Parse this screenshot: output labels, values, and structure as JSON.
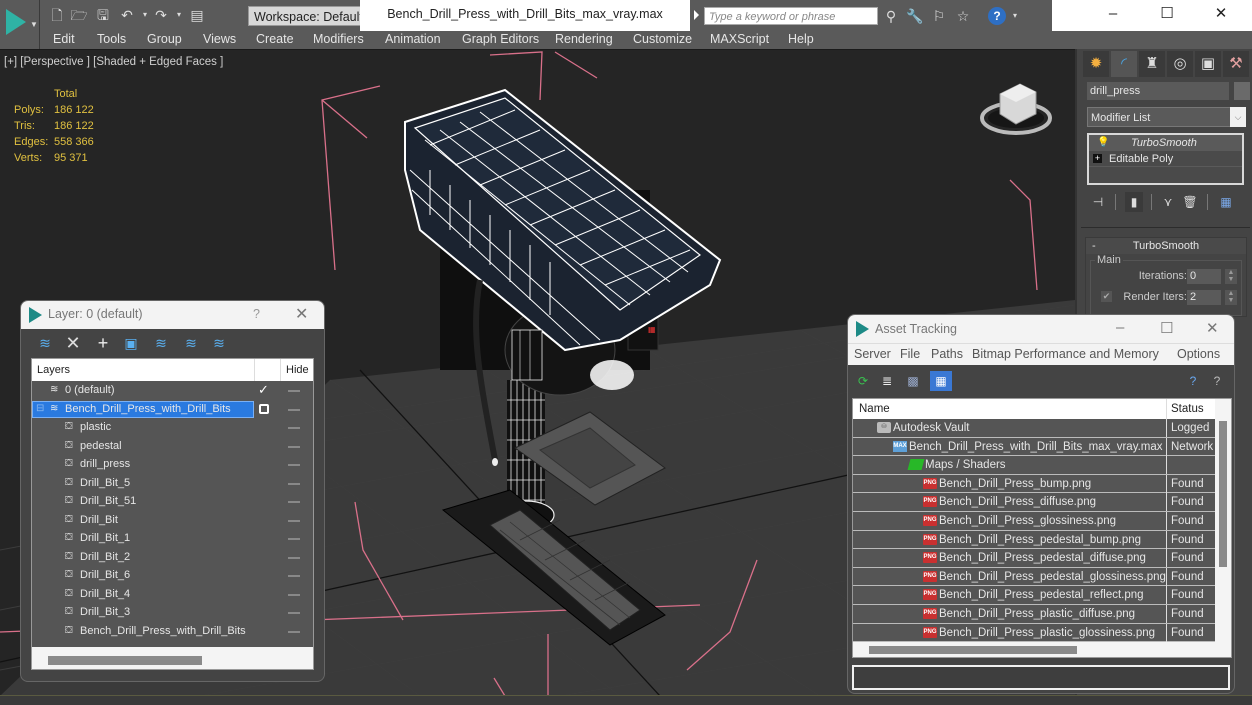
{
  "titlebar": {
    "workspace": "Workspace: Default",
    "document_title": "Bench_Drill_Press_with_Drill_Bits_max_vray.max",
    "search_placeholder": "Type a keyword or phrase",
    "icons": [
      "new-file-icon",
      "open-folder-icon",
      "save-icon",
      "undo-icon",
      "redo-icon",
      "project-folder-icon"
    ],
    "search_icons": [
      "binoculars-icon",
      "key-icon",
      "sign-in-icon",
      "star-icon"
    ],
    "help": "?",
    "minimize": "–",
    "maximize": "☐",
    "close": "✕"
  },
  "menu": [
    "Edit",
    "Tools",
    "Group",
    "Views",
    "Create",
    "Modifiers",
    "Animation",
    "Graph Editors",
    "Rendering",
    "Customize",
    "MAXScript",
    "Help"
  ],
  "viewport": {
    "label": "[+] [Perspective ] [Shaded + Edged Faces ]",
    "stats": {
      "header": "Total",
      "rows": [
        {
          "label": "Polys:",
          "value": "186 122"
        },
        {
          "label": "Tris:",
          "value": "186 122"
        },
        {
          "label": "Edges:",
          "value": "558 366"
        },
        {
          "label": "Verts:",
          "value": "95 371"
        }
      ]
    }
  },
  "command_panel": {
    "tabs": [
      "create-tab",
      "modify-tab",
      "hierarchy-tab",
      "motion-tab",
      "display-tab",
      "utilities-tab"
    ],
    "object_name": "drill_press",
    "modifier_list": "Modifier List",
    "stack": [
      {
        "label": "TurboSmooth",
        "italic": true
      },
      {
        "label": "Editable Poly",
        "italic": false
      }
    ],
    "rollout": {
      "title": "TurboSmooth",
      "minus": "-",
      "group": "Main",
      "iterations_label": "Iterations:",
      "iterations_value": "0",
      "render_iters_label": "Render Iters:",
      "render_iters_value": "2",
      "render_iters_checked": true
    }
  },
  "layer_dialog": {
    "title": "Layer: 0 (default)",
    "help": "?",
    "close": "✕",
    "col_layers": "Layers",
    "col_hide": "Hide",
    "rows": [
      {
        "name": "0 (default)",
        "type": "layer",
        "indent": 1,
        "current": true
      },
      {
        "name": "Bench_Drill_Press_with_Drill_Bits",
        "type": "layer",
        "indent": 1,
        "selected": true
      },
      {
        "name": "plastic",
        "type": "object",
        "indent": 2
      },
      {
        "name": "pedestal",
        "type": "object",
        "indent": 2
      },
      {
        "name": "drill_press",
        "type": "object",
        "indent": 2
      },
      {
        "name": "Drill_Bit_5",
        "type": "object",
        "indent": 2
      },
      {
        "name": "Drill_Bit_51",
        "type": "object",
        "indent": 2
      },
      {
        "name": "Drill_Bit",
        "type": "object",
        "indent": 2
      },
      {
        "name": "Drill_Bit_1",
        "type": "object",
        "indent": 2
      },
      {
        "name": "Drill_Bit_2",
        "type": "object",
        "indent": 2
      },
      {
        "name": "Drill_Bit_6",
        "type": "object",
        "indent": 2
      },
      {
        "name": "Drill_Bit_4",
        "type": "object",
        "indent": 2
      },
      {
        "name": "Drill_Bit_3",
        "type": "object",
        "indent": 2
      },
      {
        "name": "Bench_Drill_Press_with_Drill_Bits",
        "type": "object",
        "indent": 2
      }
    ]
  },
  "asset_dialog": {
    "title": "Asset Tracking",
    "menu": [
      "Server",
      "File",
      "Paths",
      "Bitmap Performance and Memory",
      "Options"
    ],
    "col_name": "Name",
    "col_status": "Status",
    "rows": [
      {
        "name": "Autodesk Vault",
        "status": "Logged",
        "icon": "vault",
        "indent": 1
      },
      {
        "name": "Bench_Drill_Press_with_Drill_Bits_max_vray.max",
        "status": "Network",
        "icon": "maxf",
        "indent": 2
      },
      {
        "name": "Maps / Shaders",
        "status": "",
        "icon": "maps",
        "indent": 3
      },
      {
        "name": "Bench_Drill_Press_bump.png",
        "status": "Found",
        "icon": "png",
        "indent": 4
      },
      {
        "name": "Bench_Drill_Press_diffuse.png",
        "status": "Found",
        "icon": "png",
        "indent": 4
      },
      {
        "name": "Bench_Drill_Press_glossiness.png",
        "status": "Found",
        "icon": "png",
        "indent": 4
      },
      {
        "name": "Bench_Drill_Press_pedestal_bump.png",
        "status": "Found",
        "icon": "png",
        "indent": 4
      },
      {
        "name": "Bench_Drill_Press_pedestal_diffuse.png",
        "status": "Found",
        "icon": "png",
        "indent": 4
      },
      {
        "name": "Bench_Drill_Press_pedestal_glossiness.png",
        "status": "Found",
        "icon": "png",
        "indent": 4
      },
      {
        "name": "Bench_Drill_Press_pedestal_reflect.png",
        "status": "Found",
        "icon": "png",
        "indent": 4
      },
      {
        "name": "Bench_Drill_Press_plastic_diffuse.png",
        "status": "Found",
        "icon": "png",
        "indent": 4
      },
      {
        "name": "Bench_Drill_Press_plastic_glossiness.png",
        "status": "Found",
        "icon": "png",
        "indent": 4
      }
    ]
  },
  "colors": {
    "accent_teal": "#2fb3a5",
    "selection_blue": "#2a7ae0",
    "stats_yellow": "#e0c040",
    "bbox_pink": "#d9708a"
  }
}
